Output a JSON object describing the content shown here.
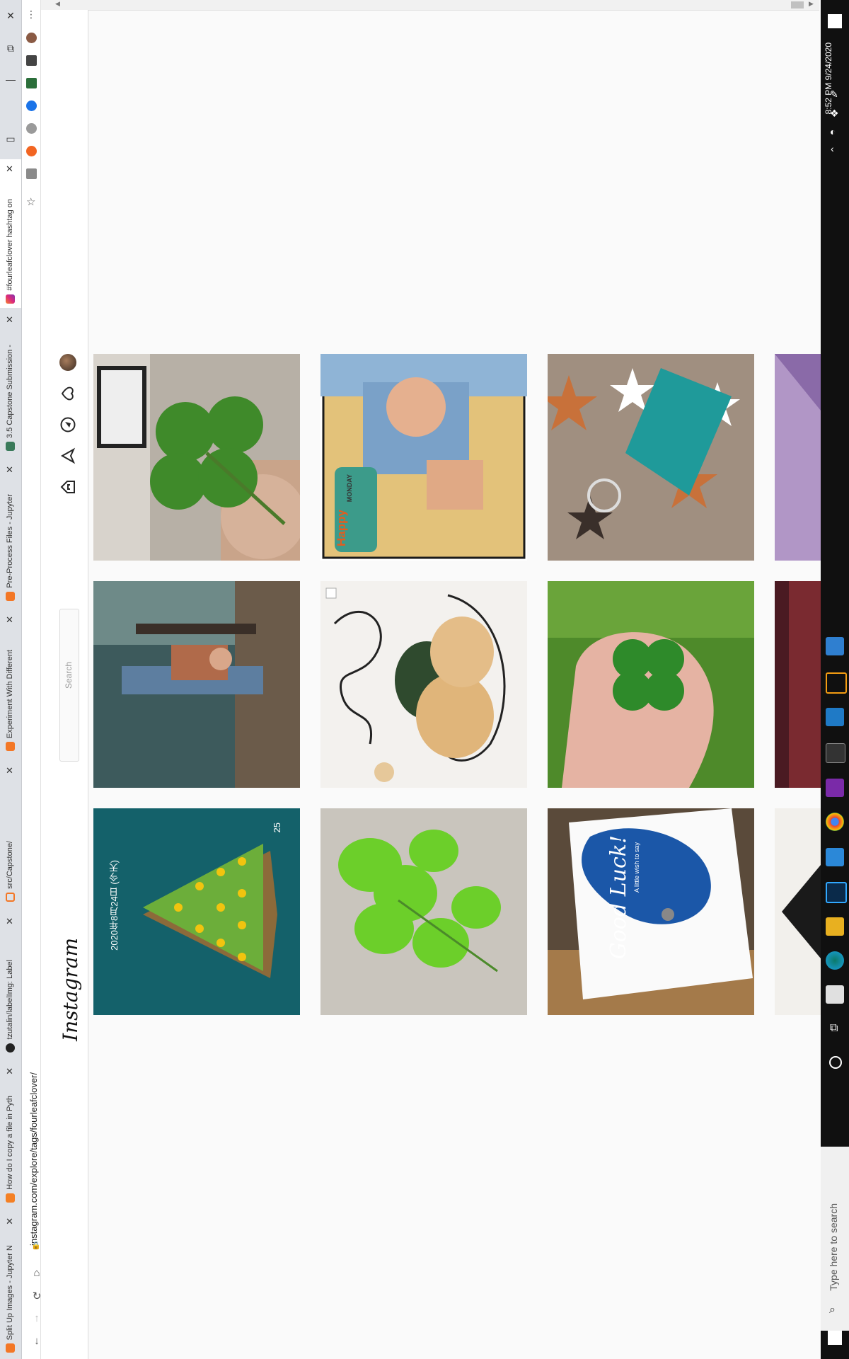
{
  "browser": {
    "tabs": [
      {
        "title": "Split Up Images - Jupyter N",
        "close": "✕"
      },
      {
        "title": "How do I copy a file in Pyth",
        "close": "✕"
      },
      {
        "title": "tzutalin/labelImg: Label",
        "close": "✕"
      },
      {
        "title": "src/Capstone/",
        "close": "✕"
      },
      {
        "title": "Experiment With Different",
        "close": "✕"
      },
      {
        "title": "Pre-Process Files - Jupyter",
        "close": "✕"
      },
      {
        "title": "3.5 Capstone Submission -",
        "close": "✕"
      },
      {
        "title": "#fourleafclover hashtag on",
        "close": "✕"
      }
    ],
    "address": "instagram.com/explore/tags/fourleafclover/",
    "window_controls": {
      "close": "✕",
      "restore": "⧉",
      "minimize": "—"
    }
  },
  "instagram": {
    "logo": "Instagram",
    "search_placeholder": "Search"
  },
  "grid": {
    "tiles": [
      {
        "desc": "four leaf clover held by fingers"
      },
      {
        "desc": "man posing with Happy Monday frame"
      },
      {
        "desc": "teal resin keychain on star fabric"
      },
      {
        "desc": "woman portrait outdoors photography"
      },
      {
        "desc": "pressed clover art drawing"
      },
      {
        "desc": "hand holding four leaf clover in grass"
      },
      {
        "desc": "clover garden game screenshot"
      },
      {
        "desc": "green clover leaves on concrete"
      },
      {
        "desc": "Good Luck blue watercolor card"
      }
    ],
    "game_date": "2020年8月24日 (今天)",
    "game_count": "25",
    "frame_text": "Happy",
    "frame_text2": "MONDAY",
    "card_title": "Good Luck!",
    "card_sub": "A little wish to say"
  },
  "taskbar": {
    "search_placeholder": "Type here to search",
    "time": "8:52 PM",
    "date": "9/24/2020"
  }
}
